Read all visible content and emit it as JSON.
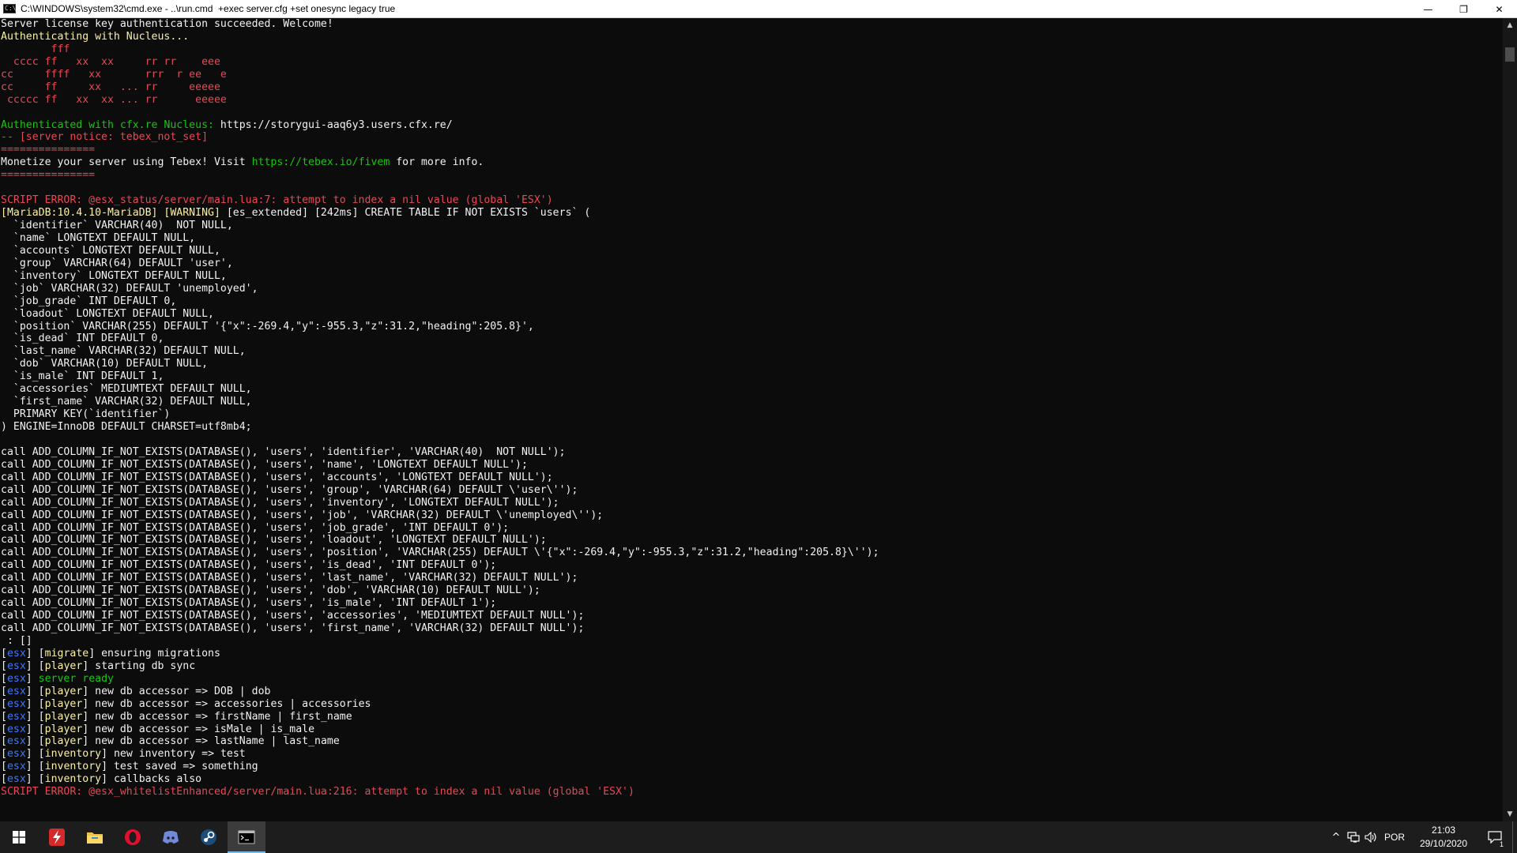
{
  "window": {
    "icon_text": "C:\\",
    "title": "C:\\WINDOWS\\system32\\cmd.exe - ..\\run.cmd  +exec server.cfg +set onesync legacy true",
    "minimize": "—",
    "restore": "❐",
    "close": "✕"
  },
  "console_lines": [
    [
      {
        "t": "Server license key authentication succeeded. Welcome!",
        "c": "white"
      }
    ],
    [
      {
        "t": "Authenticating with Nucleus...",
        "c": "yellow"
      }
    ],
    [
      {
        "t": "        fff",
        "c": "red"
      }
    ],
    [
      {
        "t": "  cccc ff   xx  xx     rr rr    eee",
        "c": "red"
      }
    ],
    [
      {
        "t": "cc     ffff   xx       rrr  r ee   e",
        "c": "red"
      }
    ],
    [
      {
        "t": "cc     ff     xx   ... rr     eeeee",
        "c": "red"
      }
    ],
    [
      {
        "t": " ccccc ff   xx  xx ... rr      eeeee",
        "c": "red"
      }
    ],
    [
      {
        "t": "",
        "c": "white"
      }
    ],
    [
      {
        "t": "Authenticated with cfx.re Nucleus: ",
        "c": "green"
      },
      {
        "t": "https://storygui-aaq6y3.users.cfx.re/",
        "c": "white"
      }
    ],
    [
      {
        "t": "-- [server notice: tebex_not_set]",
        "c": "red"
      }
    ],
    [
      {
        "t": "===============",
        "c": "red"
      }
    ],
    [
      {
        "t": "Monetize your server using Tebex! Visit ",
        "c": "white"
      },
      {
        "t": "https://tebex.io/fivem",
        "c": "green"
      },
      {
        "t": " for more info.",
        "c": "white"
      }
    ],
    [
      {
        "t": "===============",
        "c": "red"
      }
    ],
    [
      {
        "t": "",
        "c": "white"
      }
    ],
    [
      {
        "t": "SCRIPT ERROR: @esx_status/server/main.lua:7: attempt to index a nil value (global 'ESX')",
        "c": "red"
      }
    ],
    [
      {
        "t": "[MariaDB:10.4.10-MariaDB] [WARNING] ",
        "c": "yellow"
      },
      {
        "t": "[es_extended] [242ms] CREATE TABLE IF NOT EXISTS `users` (",
        "c": "white"
      }
    ],
    [
      {
        "t": "  `identifier` VARCHAR(40)  NOT NULL,",
        "c": "white"
      }
    ],
    [
      {
        "t": "  `name` LONGTEXT DEFAULT NULL,",
        "c": "white"
      }
    ],
    [
      {
        "t": "  `accounts` LONGTEXT DEFAULT NULL,",
        "c": "white"
      }
    ],
    [
      {
        "t": "  `group` VARCHAR(64) DEFAULT 'user',",
        "c": "white"
      }
    ],
    [
      {
        "t": "  `inventory` LONGTEXT DEFAULT NULL,",
        "c": "white"
      }
    ],
    [
      {
        "t": "  `job` VARCHAR(32) DEFAULT 'unemployed',",
        "c": "white"
      }
    ],
    [
      {
        "t": "  `job_grade` INT DEFAULT 0,",
        "c": "white"
      }
    ],
    [
      {
        "t": "  `loadout` LONGTEXT DEFAULT NULL,",
        "c": "white"
      }
    ],
    [
      {
        "t": "  `position` VARCHAR(255) DEFAULT '{\"x\":-269.4,\"y\":-955.3,\"z\":31.2,\"heading\":205.8}',",
        "c": "white"
      }
    ],
    [
      {
        "t": "  `is_dead` INT DEFAULT 0,",
        "c": "white"
      }
    ],
    [
      {
        "t": "  `last_name` VARCHAR(32) DEFAULT NULL,",
        "c": "white"
      }
    ],
    [
      {
        "t": "  `dob` VARCHAR(10) DEFAULT NULL,",
        "c": "white"
      }
    ],
    [
      {
        "t": "  `is_male` INT DEFAULT 1,",
        "c": "white"
      }
    ],
    [
      {
        "t": "  `accessories` MEDIUMTEXT DEFAULT NULL,",
        "c": "white"
      }
    ],
    [
      {
        "t": "  `first_name` VARCHAR(32) DEFAULT NULL,",
        "c": "white"
      }
    ],
    [
      {
        "t": "  PRIMARY KEY(`identifier`)",
        "c": "white"
      }
    ],
    [
      {
        "t": ") ENGINE=InnoDB DEFAULT CHARSET=utf8mb4;",
        "c": "white"
      }
    ],
    [
      {
        "t": "",
        "c": "white"
      }
    ],
    [
      {
        "t": "call ADD_COLUMN_IF_NOT_EXISTS(DATABASE(), 'users', 'identifier', 'VARCHAR(40)  NOT NULL');",
        "c": "white"
      }
    ],
    [
      {
        "t": "call ADD_COLUMN_IF_NOT_EXISTS(DATABASE(), 'users', 'name', 'LONGTEXT DEFAULT NULL');",
        "c": "white"
      }
    ],
    [
      {
        "t": "call ADD_COLUMN_IF_NOT_EXISTS(DATABASE(), 'users', 'accounts', 'LONGTEXT DEFAULT NULL');",
        "c": "white"
      }
    ],
    [
      {
        "t": "call ADD_COLUMN_IF_NOT_EXISTS(DATABASE(), 'users', 'group', 'VARCHAR(64) DEFAULT \\'user\\'');",
        "c": "white"
      }
    ],
    [
      {
        "t": "call ADD_COLUMN_IF_NOT_EXISTS(DATABASE(), 'users', 'inventory', 'LONGTEXT DEFAULT NULL');",
        "c": "white"
      }
    ],
    [
      {
        "t": "call ADD_COLUMN_IF_NOT_EXISTS(DATABASE(), 'users', 'job', 'VARCHAR(32) DEFAULT \\'unemployed\\'');",
        "c": "white"
      }
    ],
    [
      {
        "t": "call ADD_COLUMN_IF_NOT_EXISTS(DATABASE(), 'users', 'job_grade', 'INT DEFAULT 0');",
        "c": "white"
      }
    ],
    [
      {
        "t": "call ADD_COLUMN_IF_NOT_EXISTS(DATABASE(), 'users', 'loadout', 'LONGTEXT DEFAULT NULL');",
        "c": "white"
      }
    ],
    [
      {
        "t": "call ADD_COLUMN_IF_NOT_EXISTS(DATABASE(), 'users', 'position', 'VARCHAR(255) DEFAULT \\'{\"x\":-269.4,\"y\":-955.3,\"z\":31.2,\"heading\":205.8}\\'');",
        "c": "white"
      }
    ],
    [
      {
        "t": "call ADD_COLUMN_IF_NOT_EXISTS(DATABASE(), 'users', 'is_dead', 'INT DEFAULT 0');",
        "c": "white"
      }
    ],
    [
      {
        "t": "call ADD_COLUMN_IF_NOT_EXISTS(DATABASE(), 'users', 'last_name', 'VARCHAR(32) DEFAULT NULL');",
        "c": "white"
      }
    ],
    [
      {
        "t": "call ADD_COLUMN_IF_NOT_EXISTS(DATABASE(), 'users', 'dob', 'VARCHAR(10) DEFAULT NULL');",
        "c": "white"
      }
    ],
    [
      {
        "t": "call ADD_COLUMN_IF_NOT_EXISTS(DATABASE(), 'users', 'is_male', 'INT DEFAULT 1');",
        "c": "white"
      }
    ],
    [
      {
        "t": "call ADD_COLUMN_IF_NOT_EXISTS(DATABASE(), 'users', 'accessories', 'MEDIUMTEXT DEFAULT NULL');",
        "c": "white"
      }
    ],
    [
      {
        "t": "call ADD_COLUMN_IF_NOT_EXISTS(DATABASE(), 'users', 'first_name', 'VARCHAR(32) DEFAULT NULL');",
        "c": "white"
      }
    ],
    [
      {
        "t": " : []",
        "c": "white"
      }
    ],
    [
      {
        "t": "[",
        "c": "white"
      },
      {
        "t": "esx",
        "c": "blue"
      },
      {
        "t": "] ",
        "c": "white"
      },
      {
        "t": "[",
        "c": "white"
      },
      {
        "t": "migrate",
        "c": "yellow"
      },
      {
        "t": "] ensuring migrations",
        "c": "white"
      }
    ],
    [
      {
        "t": "[",
        "c": "white"
      },
      {
        "t": "esx",
        "c": "blue"
      },
      {
        "t": "] ",
        "c": "white"
      },
      {
        "t": "[",
        "c": "white"
      },
      {
        "t": "player",
        "c": "yellow"
      },
      {
        "t": "] starting db sync",
        "c": "white"
      }
    ],
    [
      {
        "t": "[",
        "c": "white"
      },
      {
        "t": "esx",
        "c": "blue"
      },
      {
        "t": "] ",
        "c": "white"
      },
      {
        "t": "server ready",
        "c": "green"
      }
    ],
    [
      {
        "t": "[",
        "c": "white"
      },
      {
        "t": "esx",
        "c": "blue"
      },
      {
        "t": "] ",
        "c": "white"
      },
      {
        "t": "[",
        "c": "white"
      },
      {
        "t": "player",
        "c": "yellow"
      },
      {
        "t": "] new db accessor => DOB | dob",
        "c": "white"
      }
    ],
    [
      {
        "t": "[",
        "c": "white"
      },
      {
        "t": "esx",
        "c": "blue"
      },
      {
        "t": "] ",
        "c": "white"
      },
      {
        "t": "[",
        "c": "white"
      },
      {
        "t": "player",
        "c": "yellow"
      },
      {
        "t": "] new db accessor => accessories | accessories",
        "c": "white"
      }
    ],
    [
      {
        "t": "[",
        "c": "white"
      },
      {
        "t": "esx",
        "c": "blue"
      },
      {
        "t": "] ",
        "c": "white"
      },
      {
        "t": "[",
        "c": "white"
      },
      {
        "t": "player",
        "c": "yellow"
      },
      {
        "t": "] new db accessor => firstName | first_name",
        "c": "white"
      }
    ],
    [
      {
        "t": "[",
        "c": "white"
      },
      {
        "t": "esx",
        "c": "blue"
      },
      {
        "t": "] ",
        "c": "white"
      },
      {
        "t": "[",
        "c": "white"
      },
      {
        "t": "player",
        "c": "yellow"
      },
      {
        "t": "] new db accessor => isMale | is_male",
        "c": "white"
      }
    ],
    [
      {
        "t": "[",
        "c": "white"
      },
      {
        "t": "esx",
        "c": "blue"
      },
      {
        "t": "] ",
        "c": "white"
      },
      {
        "t": "[",
        "c": "white"
      },
      {
        "t": "player",
        "c": "yellow"
      },
      {
        "t": "] new db accessor => lastName | last_name",
        "c": "white"
      }
    ],
    [
      {
        "t": "[",
        "c": "white"
      },
      {
        "t": "esx",
        "c": "blue"
      },
      {
        "t": "] ",
        "c": "white"
      },
      {
        "t": "[",
        "c": "white"
      },
      {
        "t": "inventory",
        "c": "yellow"
      },
      {
        "t": "] new inventory => test",
        "c": "white"
      }
    ],
    [
      {
        "t": "[",
        "c": "white"
      },
      {
        "t": "esx",
        "c": "blue"
      },
      {
        "t": "] ",
        "c": "white"
      },
      {
        "t": "[",
        "c": "white"
      },
      {
        "t": "inventory",
        "c": "yellow"
      },
      {
        "t": "] test saved => something",
        "c": "white"
      }
    ],
    [
      {
        "t": "[",
        "c": "white"
      },
      {
        "t": "esx",
        "c": "blue"
      },
      {
        "t": "] ",
        "c": "white"
      },
      {
        "t": "[",
        "c": "white"
      },
      {
        "t": "inventory",
        "c": "yellow"
      },
      {
        "t": "] callbacks also",
        "c": "white"
      }
    ],
    [
      {
        "t": "SCRIPT ERROR: @esx_whitelistEnhanced/server/main.lua:216: attempt to index a nil value (global 'ESX')",
        "c": "red"
      }
    ]
  ],
  "scrollbar": {
    "up_arrow": "▲",
    "down_arrow": "▼",
    "position_fraction": 0.02
  },
  "taskbar": {
    "apps": [
      {
        "name": "start",
        "icon": "windows-logo-icon",
        "active": false
      },
      {
        "name": "app-red-bolt",
        "icon": "red-bolt-icon",
        "active": false
      },
      {
        "name": "file-explorer",
        "icon": "folder-icon",
        "active": false
      },
      {
        "name": "opera",
        "icon": "opera-icon",
        "active": false
      },
      {
        "name": "discord",
        "icon": "discord-icon",
        "active": false
      },
      {
        "name": "steam",
        "icon": "steam-icon",
        "active": false
      },
      {
        "name": "cmd",
        "icon": "terminal-icon",
        "active": true
      }
    ],
    "tray": {
      "chevron": "^",
      "language": "POR",
      "time": "21:03",
      "date": "29/10/2020",
      "notification_count": "1"
    }
  },
  "colors": {
    "console_bg": "#0c0c0c",
    "white": "#f2f2f2",
    "yellow": "#f9f1a5",
    "red": "#e74856",
    "green": "#16c60c",
    "blue": "#3b78ff",
    "taskbar_bg": "#1d1d1d",
    "active_indicator": "#76b9ed"
  }
}
